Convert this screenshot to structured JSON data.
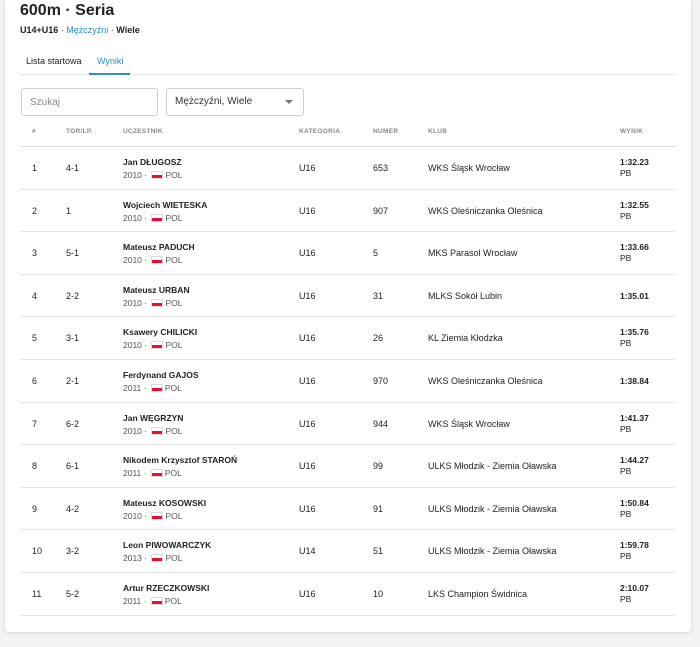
{
  "title": "600m · Seria",
  "subtitle": {
    "age": "U14+U16",
    "sep1": " · ",
    "gender": "Mężczyźni",
    "sep2": " · ",
    "type": "Wiele"
  },
  "tabs": [
    {
      "label": "Lista startowa"
    },
    {
      "label": "Wyniki"
    }
  ],
  "search": {
    "placeholder": "Szukaj"
  },
  "filter": {
    "value": "Mężczyźni, Wiele"
  },
  "columns": {
    "pos": "#",
    "lane": "TOR/LP.",
    "athlete": "UCZESTNIK",
    "category": "KATEGORIA",
    "number": "NUMER",
    "club": "KLUB",
    "result": "WYNIK"
  },
  "rows": [
    {
      "pos": "1",
      "lane": "4-1",
      "name": "Jan DŁUGOSZ",
      "year": "2010",
      "country": "POL",
      "category": "U16",
      "number": "653",
      "club": "WKS Śląsk Wrocław",
      "result": "1:32.23",
      "note": "PB"
    },
    {
      "pos": "2",
      "lane": "1",
      "name": "Wojciech WIETESKA",
      "year": "2010",
      "country": "POL",
      "category": "U16",
      "number": "907",
      "club": "WKS Oleśniczanka Oleśnica",
      "result": "1:32.55",
      "note": "PB"
    },
    {
      "pos": "3",
      "lane": "5-1",
      "name": "Mateusz PADUCH",
      "year": "2010",
      "country": "POL",
      "category": "U16",
      "number": "5",
      "club": "MKS Parasol Wrocław",
      "result": "1:33.66",
      "note": "PB"
    },
    {
      "pos": "4",
      "lane": "2-2",
      "name": "Mateusz URBAN",
      "year": "2010",
      "country": "POL",
      "category": "U16",
      "number": "31",
      "club": "MLKS Sokół Lubin",
      "result": "1:35.01",
      "note": ""
    },
    {
      "pos": "5",
      "lane": "3-1",
      "name": "Ksawery CHILICKI",
      "year": "2010",
      "country": "POL",
      "category": "U16",
      "number": "26",
      "club": "KL Ziemia Kłodzka",
      "result": "1:35.76",
      "note": "PB"
    },
    {
      "pos": "6",
      "lane": "2-1",
      "name": "Ferdynand GAJOS",
      "year": "2011",
      "country": "POL",
      "category": "U16",
      "number": "970",
      "club": "WKS Oleśniczanka Oleśnica",
      "result": "1:38.84",
      "note": ""
    },
    {
      "pos": "7",
      "lane": "6-2",
      "name": "Jan WĘGRZYN",
      "year": "2010",
      "country": "POL",
      "category": "U16",
      "number": "944",
      "club": "WKS Śląsk Wrocław",
      "result": "1:41.37",
      "note": "PB"
    },
    {
      "pos": "8",
      "lane": "6-1",
      "name": "Nikodem Krzysztof STAROŃ",
      "year": "2011",
      "country": "POL",
      "category": "U16",
      "number": "99",
      "club": "ULKS Młodzik - Ziemia Oławska",
      "result": "1:44.27",
      "note": "PB"
    },
    {
      "pos": "9",
      "lane": "4-2",
      "name": "Mateusz KOSOWSKI",
      "year": "2010",
      "country": "POL",
      "category": "U16",
      "number": "91",
      "club": "ULKS Młodzik - Ziemia Oławska",
      "result": "1:50.84",
      "note": "PB"
    },
    {
      "pos": "10",
      "lane": "3-2",
      "name": "Leon PIWOWARCZYK",
      "year": "2013",
      "country": "POL",
      "category": "U14",
      "number": "51",
      "club": "ULKS Młodzik - Ziemia Oławska",
      "result": "1:59.78",
      "note": "PB"
    },
    {
      "pos": "11",
      "lane": "5-2",
      "name": "Artur RZECZKOWSKI",
      "year": "2011",
      "country": "POL",
      "category": "U16",
      "number": "10",
      "club": "LKS Champion Świdnica",
      "result": "2:10.07",
      "note": "PB"
    }
  ]
}
